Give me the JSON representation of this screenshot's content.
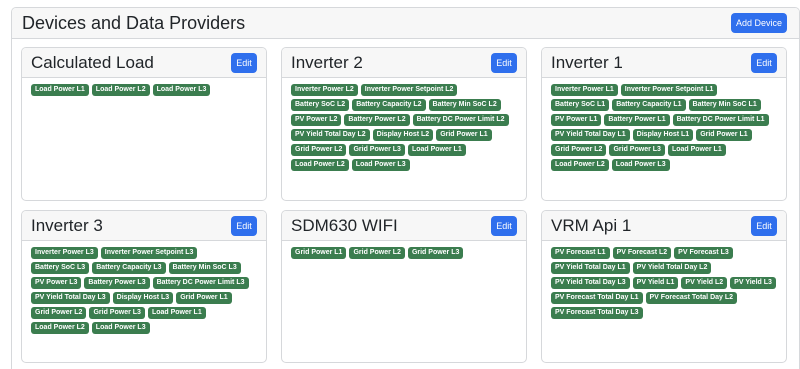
{
  "page": {
    "title": "Devices and Data Providers",
    "add_device_label": "Add Device"
  },
  "colors": {
    "primary_button": "#2f6fed",
    "badge_green": "#3b7d4f",
    "header_bg": "#f7f7f7",
    "border": "#d6d8db"
  },
  "devices": [
    {
      "name": "Calculated Load",
      "edit_label": "Edit",
      "providers": [
        "Load Power L1",
        "Load Power L2",
        "Load Power L3"
      ]
    },
    {
      "name": "Inverter 2",
      "edit_label": "Edit",
      "providers": [
        "Inverter Power L2",
        "Inverter Power Setpoint L2",
        "Battery SoC L2",
        "Battery Capacity L2",
        "Battery Min SoC L2",
        "PV Power L2",
        "Battery Power L2",
        "Battery DC Power Limit L2",
        "PV Yield Total Day L2",
        "Display Host L2",
        "Grid Power L1",
        "Grid Power L2",
        "Grid Power L3",
        "Load Power L1",
        "Load Power L2",
        "Load Power L3"
      ]
    },
    {
      "name": "Inverter 1",
      "edit_label": "Edit",
      "providers": [
        "Inverter Power L1",
        "Inverter Power Setpoint L1",
        "Battery SoC L1",
        "Battery Capacity L1",
        "Battery Min SoC L1",
        "PV Power L1",
        "Battery Power L1",
        "Battery DC Power Limit L1",
        "PV Yield Total Day L1",
        "Display Host L1",
        "Grid Power L1",
        "Grid Power L2",
        "Grid Power L3",
        "Load Power L1",
        "Load Power L2",
        "Load Power L3"
      ]
    },
    {
      "name": "Inverter 3",
      "edit_label": "Edit",
      "providers": [
        "Inverter Power L3",
        "Inverter Power Setpoint L3",
        "Battery SoC L3",
        "Battery Capacity L3",
        "Battery Min SoC L3",
        "PV Power L3",
        "Battery Power L3",
        "Battery DC Power Limit L3",
        "PV Yield Total Day L3",
        "Display Host L3",
        "Grid Power L1",
        "Grid Power L2",
        "Grid Power L3",
        "Load Power L1",
        "Load Power L2",
        "Load Power L3"
      ]
    },
    {
      "name": "SDM630 WIFI",
      "edit_label": "Edit",
      "providers": [
        "Grid Power L1",
        "Grid Power L2",
        "Grid Power L3"
      ]
    },
    {
      "name": "VRM Api 1",
      "edit_label": "Edit",
      "providers": [
        "PV Forecast L1",
        "PV Forecast L2",
        "PV Forecast L3",
        "PV Yield Total Day L1",
        "PV Yield Total Day L2",
        "PV Yield Total Day L3",
        "PV Yield L1",
        "PV Yield L2",
        "PV Yield L3",
        "PV Forecast Total Day L1",
        "PV Forecast Total Day L2",
        "PV Forecast Total Day L3"
      ]
    }
  ]
}
